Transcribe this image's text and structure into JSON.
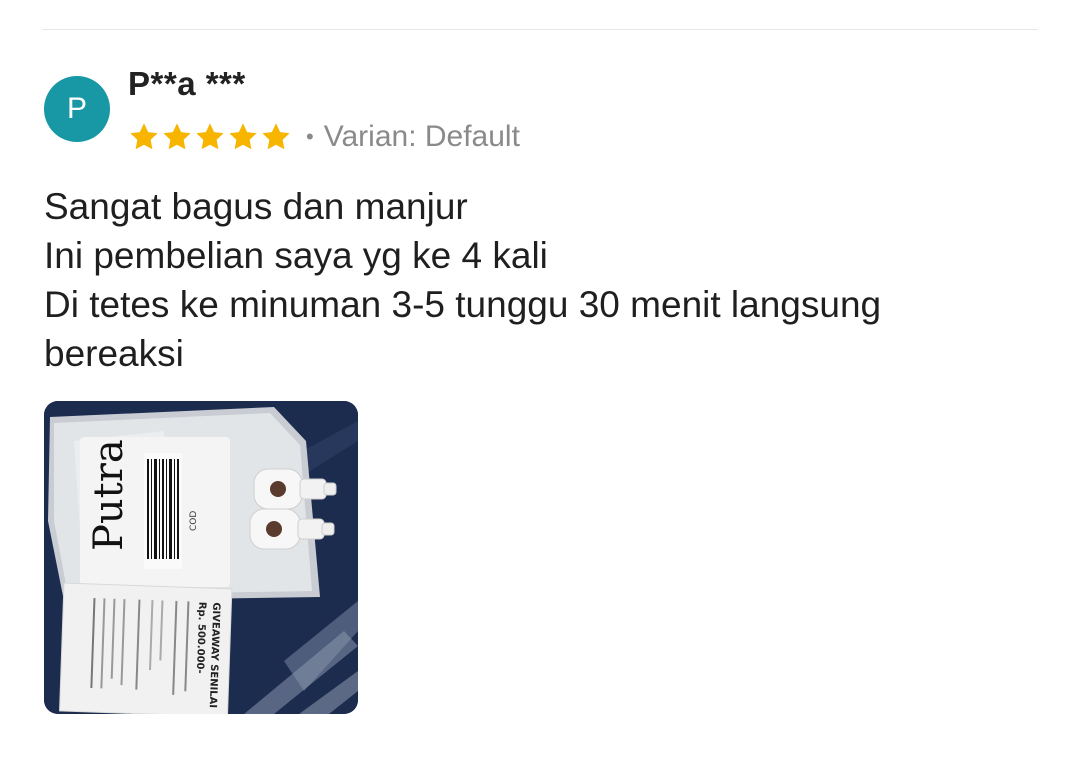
{
  "review": {
    "avatar_initial": "P",
    "reviewer_name": "P**a ***",
    "rating": 5,
    "rating_max": 5,
    "variant_label": "Varian: Default",
    "text_lines": [
      "Sangat bagus dan manjur",
      "Ini pembelian saya yg ke 4 kali",
      "Di tetes ke minuman 3-5 tunggu 30 menit langsung",
      "bereaksi"
    ],
    "photo": {
      "handwritten_label": "Putra",
      "package_code": "COD",
      "flyer_title": "GIVEAWAY SENILAI",
      "flyer_amount": "Rp. 500.000-"
    }
  },
  "colors": {
    "avatar_bg": "#1798a4",
    "star": "#f7b500",
    "muted_text": "#8a8a8a"
  },
  "icons": {
    "star": "star-icon"
  }
}
